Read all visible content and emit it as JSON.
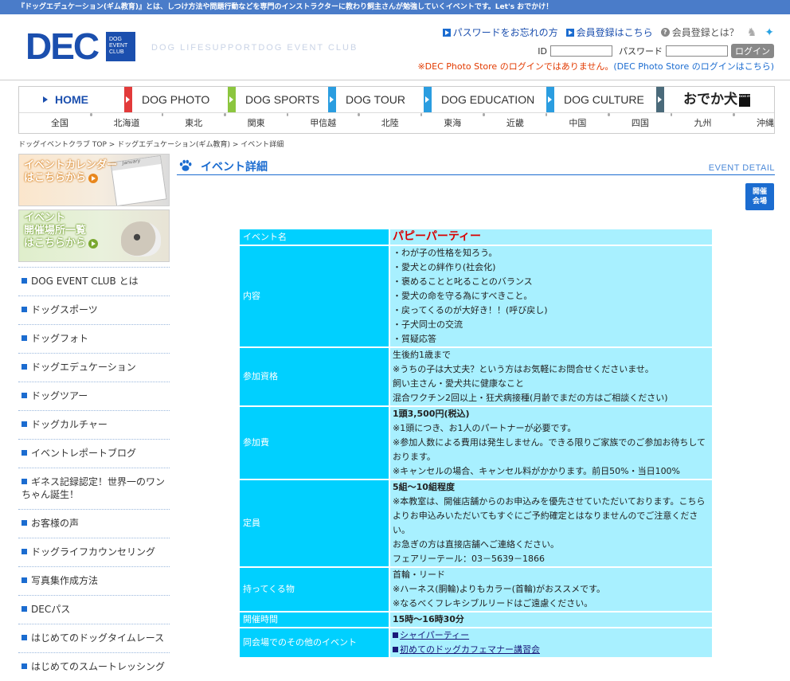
{
  "topbar": "『ドッグエデュケーション(ギム教育)』とは、しつけ方法や問題行動などを専門のインストラクターに教わり飼主さんが勉強していくイベントです。Let's おでかけ！",
  "header": {
    "logo_main": "DEC",
    "logo_sub": [
      "DOG",
      "EVENT",
      "CLUB"
    ],
    "tagline": "DOG LIFESUPPORTDOG EVENT CLUB",
    "links": {
      "forgot_password": "パスワードをお忘れの方",
      "register": "会員登録はこちら",
      "about_member": "会員登録とは？"
    },
    "login": {
      "id_label": "ID",
      "password_label": "パスワード",
      "button": "ログイン"
    },
    "notice_red": "※DEC Photo Store のログインではありません。",
    "notice_blue": "(DEC Photo Store のログインはこちら)"
  },
  "nav": {
    "items": [
      {
        "label": "HOME",
        "color": "#1b4fae"
      },
      {
        "label": "DOG PHOTO",
        "color": "#e23a3a"
      },
      {
        "label": "DOG SPORTS",
        "color": "#8cc63f"
      },
      {
        "label": "DOG TOUR",
        "color": "#2a9de0"
      },
      {
        "label": "DOG EDUCATION",
        "color": "#2a9de0"
      },
      {
        "label": "DOG CULTURE",
        "color": "#2a9de0"
      }
    ],
    "odeka_label": "おでか犬",
    "odeka_mini": "DOG EVENT CLUB",
    "regions": [
      "全国",
      "北海道",
      "東北",
      "関東",
      "甲信越",
      "北陸",
      "東海",
      "近畿",
      "中国",
      "四国",
      "九州",
      "沖縄"
    ]
  },
  "breadcrumb": "ドッグイベントクラブ TOP > ドッグエデュケーション(ギム教育) > イベント詳細",
  "sidebar": {
    "banner1": {
      "line1": "イベントカレンダー",
      "line2": "はこちらから",
      "cal_label": "January"
    },
    "banner2": {
      "line1": "イベント",
      "line2": "開催場所一覧",
      "line3": "はこちらから"
    },
    "items": [
      "DOG EVENT CLUB とは",
      "ドッグスポーツ",
      "ドッグフォト",
      "ドッグエデュケーション",
      "ドッグツアー",
      "ドッグカルチャー",
      "イベントレポートブログ",
      "ギネス記録認定！世界一のワンちゃん誕生！",
      "お客様の声",
      "ドッグライフカウンセリング",
      "写真集作成方法",
      "DECパス",
      "はじめてのドッグタイムレース",
      "はじめてのスムートレッシング"
    ]
  },
  "main": {
    "title": "イベント詳細",
    "title_en": "EVENT DETAIL",
    "venue_button": [
      "開催",
      "会場"
    ],
    "rows": [
      {
        "key": "イベント名",
        "value": [
          "パピーパーティー"
        ]
      },
      {
        "key": "内容",
        "value": [
          "・わが子の性格を知ろう。",
          "・愛犬との絆作り(社会化)",
          "・褒めることと叱ることのバランス",
          "・愛犬の命を守る為にすべきこと。",
          "・戻ってくるのが大好き！！(呼び戻し)",
          "・子犬同士の交流",
          "・質疑応答"
        ]
      },
      {
        "key": "参加資格",
        "value": [
          " 生後約1歳まで",
          " ※うちの子は大丈夫？という方はお気軽にお問合せくださいませ。",
          " 飼い主さん・愛犬共に健康なこと",
          " 混合ワクチン2回以上・狂犬病接種(月齢でまだの方はご相談ください)"
        ]
      },
      {
        "key": "参加費",
        "value": [
          " 1頭3,500円(税込)",
          "※1頭につき、お1人のパートナーが必要です。",
          "※参加人数による費用は発生しません。できる限りご家族でのご参加お待ちしております。",
          " ※キャンセルの場合、キャンセル料がかかります。前日50%・当日100%"
        ]
      },
      {
        "key": "定員",
        "value": [
          "5組～10組程度",
          "※本教室は、開催店舗からのお申込みを優先させていただいております。こちらよりお申込みいただいてもすぐにご予約確定とはなりませんのでご注意ください。",
          "お急ぎの方は直接店舗へご連絡ください。",
          "フェアリーテール：03－5639－1866"
        ]
      },
      {
        "key": "持ってくる物",
        "value": [
          "首輪・リード",
          "※ハーネス(胴輪)よりもカラー(首輪)がおススメです。",
          "※なるべくフレキシブルリードはご遠慮ください。"
        ]
      },
      {
        "key": "開催時間",
        "value": [
          " 15時～16時30分"
        ]
      },
      {
        "key": "同会場でのその他のイベント",
        "value": [
          "シャイパーティー",
          "初めてのドッグカフェマナー講習会"
        ]
      }
    ]
  }
}
